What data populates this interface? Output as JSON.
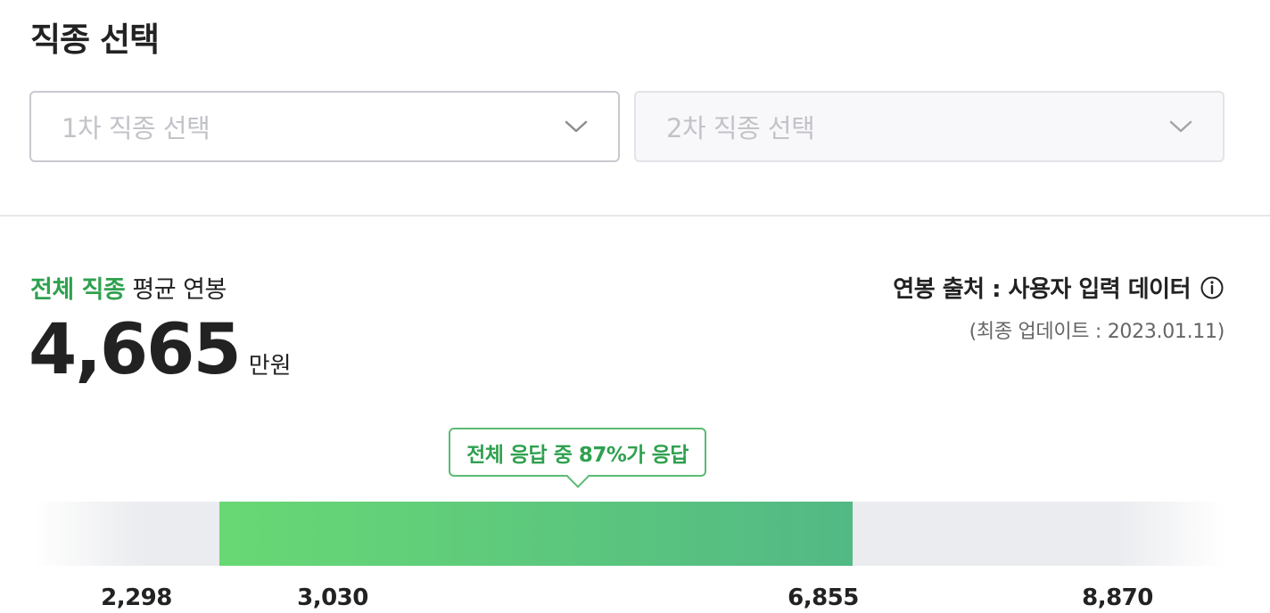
{
  "section": {
    "title": "직종 선택"
  },
  "selects": [
    {
      "placeholder": "1차 직종 선택"
    },
    {
      "placeholder": "2차 직종 선택"
    }
  ],
  "salary": {
    "label_accent": "전체 직종",
    "label_rest": "평균 연봉",
    "average": "4,665",
    "unit": "만원"
  },
  "source": {
    "text": "연봉 출처 : 사용자 입력 데이터",
    "updated": "(최종 업데이트 : 2023.01.11)"
  },
  "distribution": {
    "tooltip": "전체 응답 중 87%가 응답",
    "min": 2298,
    "max": 8870,
    "range_start": 3030,
    "range_end": 6855,
    "labels": [
      "2,298",
      "3,030",
      "6,855",
      "8,870"
    ],
    "accent_start": "#68d874",
    "accent_end": "#52b985"
  }
}
